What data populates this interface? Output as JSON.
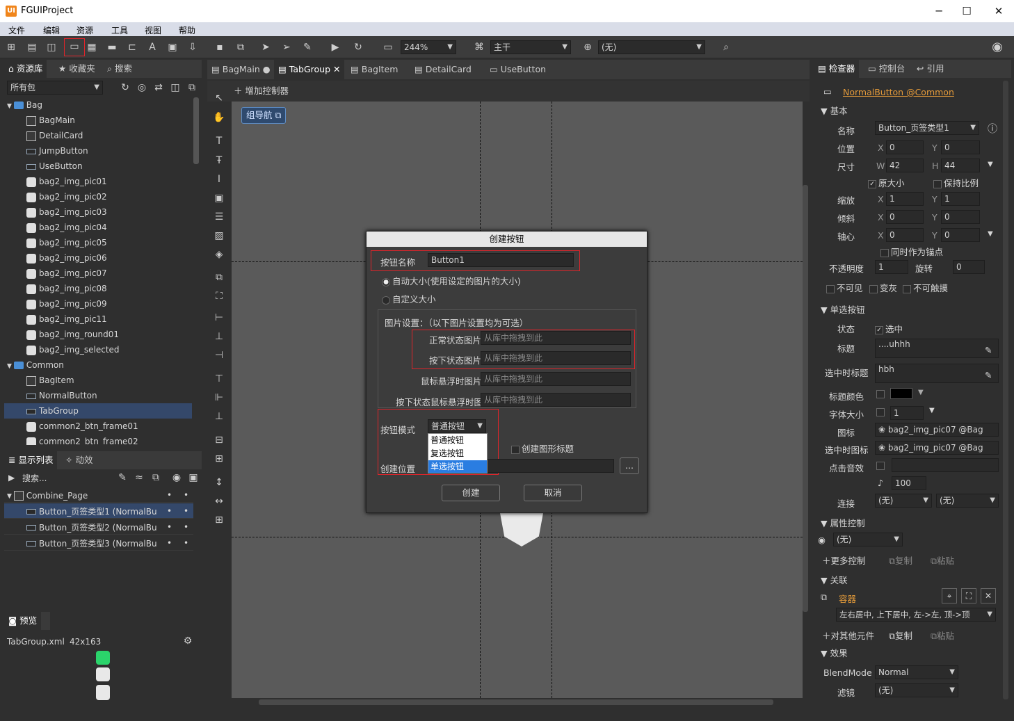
{
  "app": {
    "title": "FGUIProject",
    "logo": "UI"
  },
  "window": {
    "min": "─",
    "max": "☐",
    "close": "✕"
  },
  "menu": [
    "文件",
    "编辑",
    "资源",
    "工具",
    "视图",
    "帮助"
  ],
  "toolbar": {
    "zoom": "244%",
    "branch": "主干",
    "lang": "(无)"
  },
  "lib": {
    "tabs": [
      "资源库",
      "收藏夹",
      "搜索"
    ],
    "filter": "所有包",
    "items": [
      {
        "label": "Bag",
        "type": "folder"
      },
      {
        "label": "BagMain",
        "type": "doc"
      },
      {
        "label": "DetailCard",
        "type": "doc"
      },
      {
        "label": "JumpButton",
        "type": "btn"
      },
      {
        "label": "UseButton",
        "type": "btn"
      },
      {
        "label": "bag2_img_pic01",
        "type": "img"
      },
      {
        "label": "bag2_img_pic02",
        "type": "img"
      },
      {
        "label": "bag2_img_pic03",
        "type": "img"
      },
      {
        "label": "bag2_img_pic04",
        "type": "img"
      },
      {
        "label": "bag2_img_pic05",
        "type": "img"
      },
      {
        "label": "bag2_img_pic06",
        "type": "img"
      },
      {
        "label": "bag2_img_pic07",
        "type": "img"
      },
      {
        "label": "bag2_img_pic08",
        "type": "img"
      },
      {
        "label": "bag2_img_pic09",
        "type": "img"
      },
      {
        "label": "bag2_img_pic11",
        "type": "img"
      },
      {
        "label": "bag2_img_round01",
        "type": "img"
      },
      {
        "label": "bag2_img_selected",
        "type": "img"
      },
      {
        "label": "Common",
        "type": "folder"
      },
      {
        "label": "BagItem",
        "type": "doc"
      },
      {
        "label": "NormalButton",
        "type": "btn"
      },
      {
        "label": "TabGroup",
        "type": "btn",
        "selected": true
      },
      {
        "label": "common2_btn_frame01",
        "type": "img"
      },
      {
        "label": "common2_btn_frame02",
        "type": "img"
      }
    ]
  },
  "display": {
    "tabs": [
      "显示列表",
      "动效"
    ],
    "search": "搜索...",
    "items": [
      {
        "label": "Combine_Page"
      },
      {
        "label": "Button_页签类型1 (NormalBut",
        "selected": true
      },
      {
        "label": "Button_页签类型2 (NormalBut"
      },
      {
        "label": "Button_页签类型3 (NormalBut"
      }
    ]
  },
  "preview": {
    "tab": "预览",
    "file": "TabGroup.xml",
    "size": "42x163"
  },
  "docs": {
    "tabs": [
      "BagMain",
      "TabGroup",
      "BagItem",
      "DetailCard",
      "UseButton"
    ],
    "dirty": "●",
    "close": "✕"
  },
  "stage": {
    "add_controller": "增加控制器",
    "group_nav": "组导航"
  },
  "dialog": {
    "title": "创建按钮",
    "name_label": "按钮名称",
    "name_value": "Button1",
    "auto_size": "自动大小(使用设定的图片的大小)",
    "custom_size": "自定义大小",
    "img_settings": "图片设置：（以下图片设置均为可选）",
    "up_label": "正常状态图片",
    "down_label": "按下状态图片",
    "over_label": "鼠标悬浮时图片",
    "down_over_label": "按下状态鼠标悬浮时图",
    "drag_hint": "从库中拖拽到此",
    "mode_label": "按钮模式",
    "mode_value": "普通按钮",
    "mode_options": [
      "普通按钮",
      "复选按钮",
      "单选按钮"
    ],
    "create_title": "创建图形标题",
    "location_label": "创建位置",
    "browse": "...",
    "ok": "创建",
    "cancel": "取消"
  },
  "inspector": {
    "tabs": [
      "检查器",
      "控制台",
      "引用"
    ],
    "target": "NormalButton @Common",
    "basic": "基本",
    "name_label": "名称",
    "name_value": "Button_页签类型1",
    "pos_label": "位置",
    "x": "0",
    "y": "0",
    "size_label": "尺寸",
    "w": "42",
    "h": "44",
    "orig_size": "原大小",
    "keep_ratio": "保持比例",
    "scale_label": "缩放",
    "sx": "1",
    "sy": "1",
    "skew_label": "倾斜",
    "kx": "0",
    "ky": "0",
    "pivot_label": "轴心",
    "px": "0",
    "py": "0",
    "anchor": "同时作为锚点",
    "alpha_label": "不透明度",
    "alpha": "1",
    "rot_label": "旋转",
    "rot": "0",
    "invisible": "不可见",
    "gray": "变灰",
    "untouchable": "不可触摸",
    "radio": "单选按钮",
    "state_label": "状态",
    "state_value": "选中",
    "title_label": "标题",
    "title_value": "....uhhh",
    "sel_title_label": "选中时标题",
    "sel_title_value": "hbh",
    "title_color_label": "标题颜色",
    "font_size_label": "字体大小",
    "font_size": "1",
    "icon_label": "图标",
    "icon_value": "bag2_img_pic07 @Bag",
    "sel_icon_label": "选中时图标",
    "sel_icon_value": "bag2_img_pic07 @Bag",
    "sound_label": "点击音效",
    "volume": "100",
    "link_label": "连接",
    "link1": "(无)",
    "link2": "(无)",
    "prop_ctrl": "属性控制",
    "prop_value": "(无)",
    "more_ctrl": "更多控制",
    "copy": "复制",
    "paste": "粘贴",
    "relation": "关联",
    "container": "容器",
    "relation_value": "左右居中, 上下居中, 左->左, 顶->顶",
    "other_rel": "对其他元件",
    "effect": "效果",
    "blend_label": "BlendMode",
    "blend_value": "Normal",
    "filter_label": "滤镜",
    "filter_value": "(无)"
  }
}
